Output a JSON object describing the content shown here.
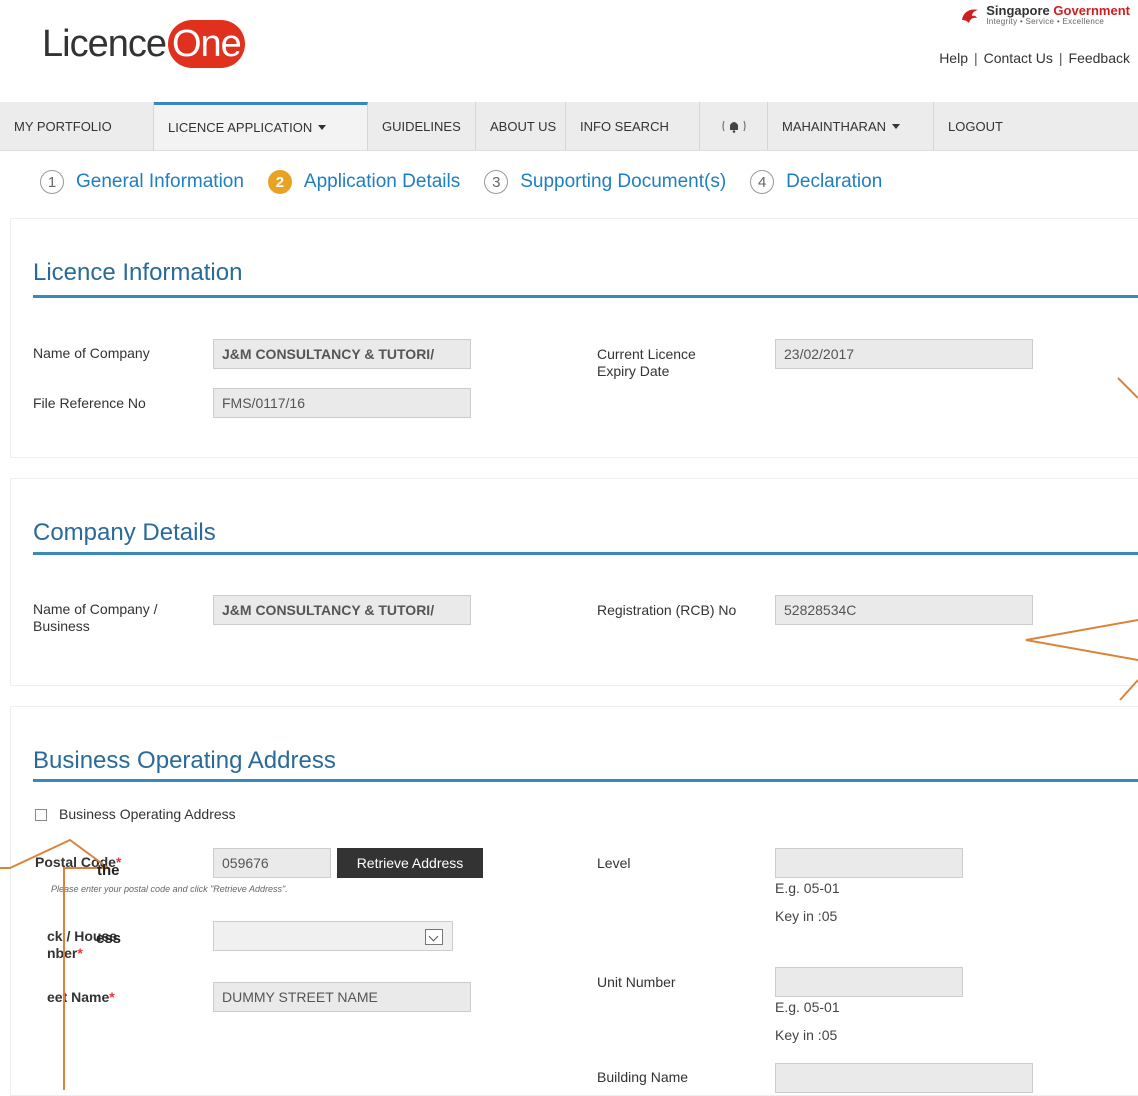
{
  "header": {
    "logo_text": "Licence",
    "logo_badge": "One",
    "gov_title_a": "Singapore",
    "gov_title_b": "Government",
    "gov_motto": "Integrity • Service • Excellence",
    "links": [
      "Help",
      "Contact Us",
      "Feedback"
    ]
  },
  "nav": {
    "items": [
      "MY PORTFOLIO",
      "LICENCE APPLICATION",
      "GUIDELINES",
      "ABOUT US",
      "INFO SEARCH",
      "",
      "MAHAINTHARAN",
      "LOGOUT"
    ]
  },
  "steps": [
    {
      "num": "1",
      "label": "General Information"
    },
    {
      "num": "2",
      "label": "Application Details"
    },
    {
      "num": "3",
      "label": "Supporting Document(s)"
    },
    {
      "num": "4",
      "label": "Declaration"
    }
  ],
  "licence": {
    "title": "Licence Information",
    "name_label": "Name of Company",
    "name_value": "J&M CONSULTANCY & TUTORI/",
    "file_label": "File Reference No",
    "file_value": "FMS/0117/16",
    "expiry_label_1": "Current Licence",
    "expiry_label_2": "Expiry Date",
    "expiry_value": "23/02/2017"
  },
  "company": {
    "title": "Company Details",
    "name_label_1": "Name of Company /",
    "name_label_2": "Business",
    "name_value": "J&M CONSULTANCY & TUTORI/",
    "rcb_label": "Registration (RCB) No",
    "rcb_value": "52828534C"
  },
  "address": {
    "title": "Business Operating Address",
    "checkbox_label": "Business Operating Address",
    "postal_label": "Postal Code",
    "postal_value": "059676",
    "retrieve_label": "Retrieve Address",
    "postal_hint": "Please enter your postal code and click \"Retrieve Address\".",
    "block_label_1": "ck / House",
    "block_label_2": "nber",
    "block_value": "",
    "street_label": "eet Name",
    "street_value": "DUMMY STREET NAME",
    "level_label": "Level",
    "level_value": "",
    "level_hint_1": "E.g. 05-01",
    "level_hint_2": "Key in :05",
    "unit_label": "Unit Number",
    "unit_value": "",
    "unit_hint_1": "E.g. 05-01",
    "unit_hint_2": "Key in :05",
    "building_label": "Building Name",
    "building_value": "",
    "required_mark": "*"
  },
  "callout": {
    "line1": "the",
    "line2": "ess"
  },
  "colors": {
    "accent": "#3a8ab8",
    "step_active": "#e8a324",
    "callout": "#d9843a",
    "logo_red": "#e0301e"
  }
}
